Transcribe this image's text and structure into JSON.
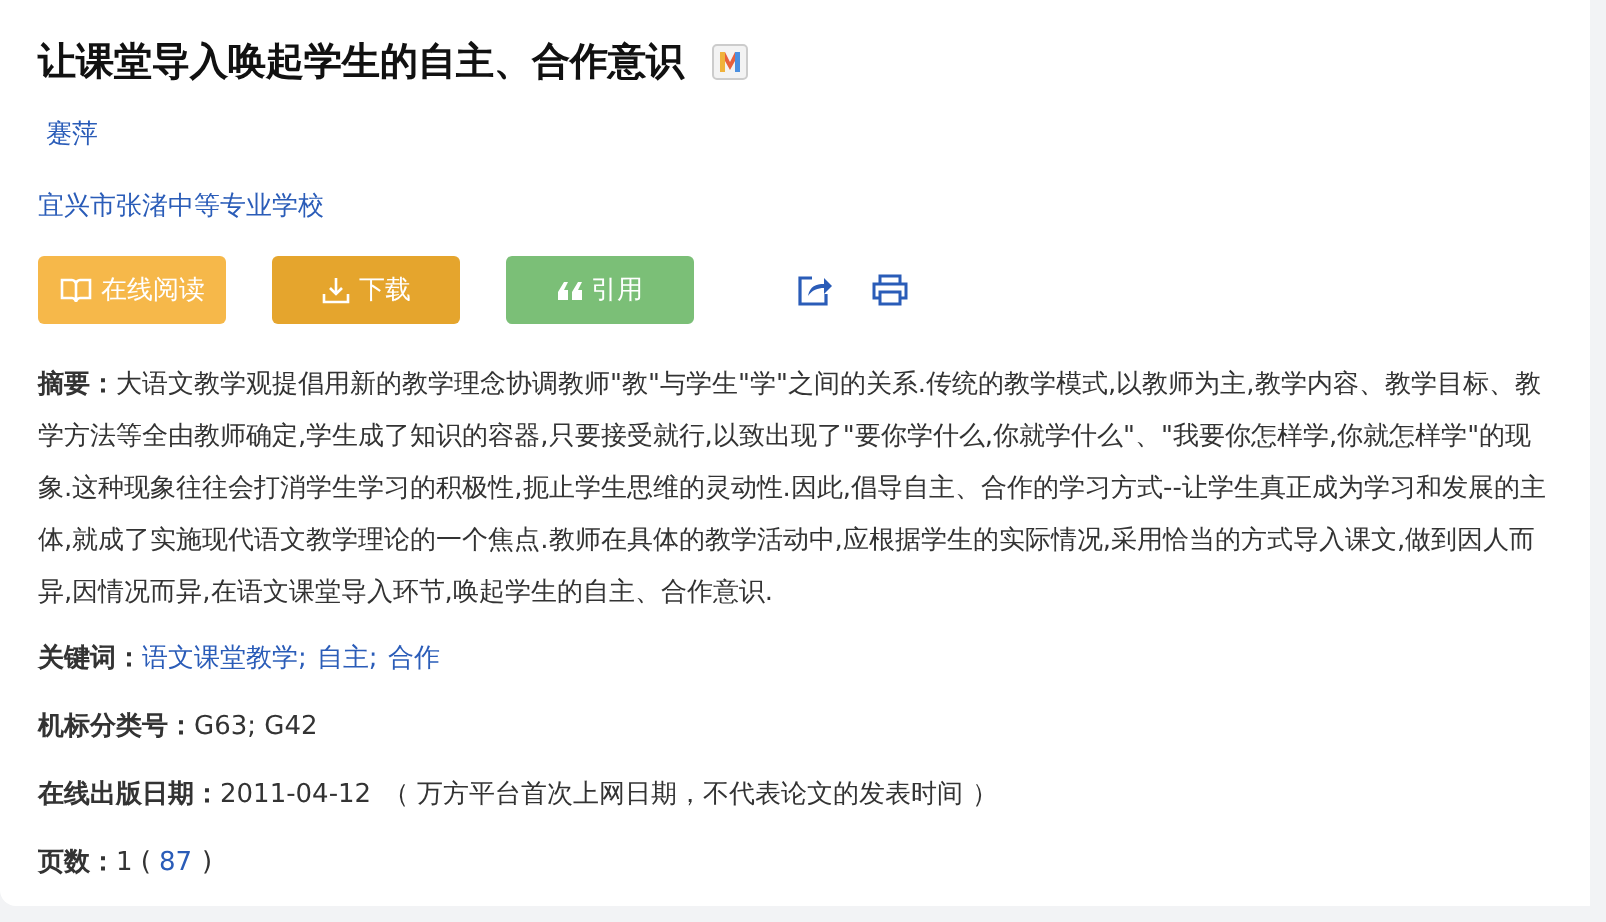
{
  "title": "让课堂导入唤起学生的自主、合作意识",
  "author": "蹇萍",
  "affiliation": "宜兴市张渚中等专业学校",
  "actions": [
    {
      "kind": "read",
      "label": "在线阅读"
    },
    {
      "kind": "download",
      "label": "下载"
    },
    {
      "kind": "cite",
      "label": "引用"
    }
  ],
  "abstract": {
    "label": "摘要：",
    "text": "大语文教学观提倡用新的教学理念协调教师\"教\"与学生\"学\"之间的关系.传统的教学模式,以教师为主,教学内容、教学目标、教学方法等全由教师确定,学生成了知识的容器,只要接受就行,以致出现了\"要你学什么,你就学什么\"、\"我要你怎样学,你就怎样学\"的现象.这种现象往往会打消学生学习的积极性,扼止学生思维的灵动性.因此,倡导自主、合作的学习方式--让学生真正成为学习和发展的主体,就成了实施现代语文教学理论的一个焦点.教师在具体的教学活动中,应根据学生的实际情况,采用恰当的方式导入课文,做到因人而异,因情况而异,在语文课堂导入环节,唤起学生的自主、合作意识."
  },
  "keywords": {
    "label": "关键词：",
    "items": [
      "语文课堂教学;",
      "自主;",
      "合作"
    ]
  },
  "classification": {
    "label": "机标分类号：",
    "value": "G63; G42"
  },
  "publish_date": {
    "label": "在线出版日期：",
    "value": "2011-04-12",
    "note": "（ 万方平台首次上网日期，不代表论文的发表时间 ）"
  },
  "pages": {
    "label": "页数：",
    "value": "1 (",
    "link": "87",
    "close": ")"
  }
}
